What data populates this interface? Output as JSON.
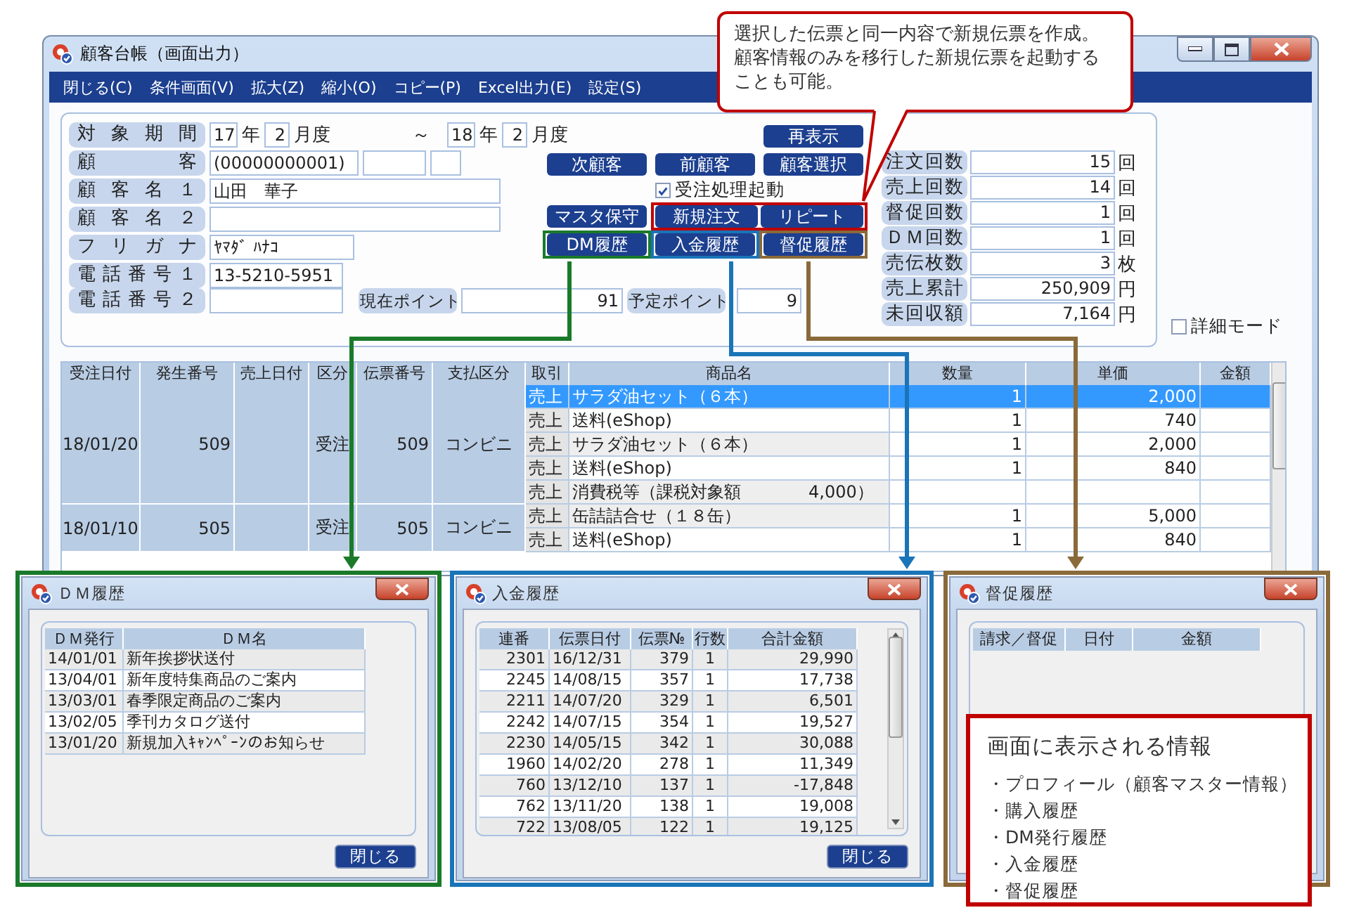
{
  "window": {
    "title": "顧客台帳（画面出力）"
  },
  "menu": [
    "閉じる(C)",
    "条件画面(V)",
    "拡大(Z)",
    "縮小(O)",
    "コピー(P)",
    "Excel出力(E)",
    "設定(S)"
  ],
  "form": {
    "period": {
      "label": "対象期間",
      "from_year": "17",
      "from_year_unit": "年",
      "from_month": "2",
      "from_month_unit": "月度",
      "separator": "～",
      "to_year": "18",
      "to_year_unit": "年",
      "to_month": "2",
      "to_month_unit": "月度"
    },
    "customer": {
      "label": "顧客",
      "code": "(00000000001)"
    },
    "name1": {
      "label": "顧客名１",
      "value": "山田　華子"
    },
    "name2": {
      "label": "顧客名２"
    },
    "kana": {
      "label": "フリガナ",
      "value": "ﾔﾏﾀﾞ ﾊﾅｺ"
    },
    "phone1": {
      "label": "電話番号１",
      "value": "13-5210-5951"
    },
    "phone2": {
      "label": "電話番号２"
    },
    "current_point": {
      "label": "現在ポイント",
      "value": "91"
    },
    "planned_point": {
      "label": "予定ポイント",
      "value": "9"
    }
  },
  "reload_button": "再表示",
  "nav_buttons": [
    "次顧客",
    "前顧客",
    "顧客選択"
  ],
  "auto_order": {
    "label": "受注処理起動",
    "checked": true
  },
  "action_buttons": [
    "マスタ保守",
    "新規注文",
    "リピート"
  ],
  "history_buttons": [
    {
      "label": "DM履歴",
      "color": "#1a7a2a"
    },
    {
      "label": "入金履歴",
      "color": "#1a74b8"
    },
    {
      "label": "督促履歴",
      "color": "#8a6a3a"
    }
  ],
  "stats": [
    {
      "label": "注文回数",
      "value": "15",
      "unit": "回"
    },
    {
      "label": "売上回数",
      "value": "14",
      "unit": "回"
    },
    {
      "label": "督促回数",
      "value": "1",
      "unit": "回"
    },
    {
      "label": "ＤＭ回数",
      "value": "1",
      "unit": "回"
    },
    {
      "label": "売伝枚数",
      "value": "3",
      "unit": "枚"
    },
    {
      "label": "売上累計",
      "value": "250,909",
      "unit": "円"
    },
    {
      "label": "未回収額",
      "value": "7,164",
      "unit": "円"
    }
  ],
  "detail_mode": {
    "label": "詳細モード",
    "checked": false
  },
  "table": {
    "columns": [
      "受注日付",
      "発生番号",
      "売上日付",
      "区分",
      "伝票番号",
      "支払区分",
      "取引",
      "商品名",
      "数量",
      "単価",
      "金額"
    ],
    "groups": [
      {
        "order_date": "18/01/20",
        "occur_no": "509",
        "type": "受注",
        "slip_no": "509",
        "payment": "コンビニ",
        "lines": [
          {
            "deal": "売上",
            "item": "サラダ油セット（６本）",
            "qty": "1",
            "price": "2,000",
            "selected": true
          },
          {
            "deal": "売上",
            "item": "送料(eShop)",
            "qty": "1",
            "price": "740",
            "selected": false
          },
          {
            "deal": "売上",
            "item": "サラダ油セット（６本）",
            "qty": "1",
            "price": "2,000",
            "selected": false
          },
          {
            "deal": "売上",
            "item": "送料(eShop)",
            "qty": "1",
            "price": "840",
            "selected": false
          },
          {
            "deal": "売上",
            "item": "消費税等（課税対象額　　　　4,000）",
            "selected": false
          }
        ]
      },
      {
        "order_date": "18/01/10",
        "occur_no": "505",
        "type": "受注",
        "slip_no": "505",
        "payment": "コンビニ",
        "lines": [
          {
            "deal": "売上",
            "item": "缶詰詰合せ（１８缶）",
            "qty": "1",
            "price": "5,000",
            "selected": false
          },
          {
            "deal": "売上",
            "item": "送料(eShop)",
            "qty": "1",
            "price": "840",
            "selected": false
          }
        ]
      }
    ]
  },
  "callout": {
    "text": "選択した伝票と同一内容で新規伝票を作成。顧客情報のみを移行した新規伝票を起動することも可能。"
  },
  "dm_history": {
    "title": "ＤＭ履歴",
    "columns": [
      "ＤＭ発行",
      "ＤＭ名"
    ],
    "rows": [
      [
        "14/01/01",
        "新年挨拶状送付"
      ],
      [
        "13/04/01",
        "新年度特集商品のご案内"
      ],
      [
        "13/03/01",
        "春季限定商品のご案内"
      ],
      [
        "13/02/05",
        "季刊カタログ送付"
      ],
      [
        "13/01/20",
        "新規加入ｷｬﾝﾍﾟｰﾝのお知らせ"
      ]
    ],
    "close_button": "閉じる"
  },
  "payment_history": {
    "title": "入金履歴",
    "columns": [
      "連番",
      "伝票日付",
      "伝票№",
      "行数",
      "合計金額"
    ],
    "rows": [
      [
        "2301",
        "16/12/31",
        "379",
        "1",
        "29,990"
      ],
      [
        "2245",
        "14/08/15",
        "357",
        "1",
        "17,738"
      ],
      [
        "2211",
        "14/07/20",
        "329",
        "1",
        "6,501"
      ],
      [
        "2242",
        "14/07/15",
        "354",
        "1",
        "19,527"
      ],
      [
        "2230",
        "14/05/15",
        "342",
        "1",
        "30,088"
      ],
      [
        "1960",
        "14/02/20",
        "278",
        "1",
        "11,349"
      ],
      [
        "760",
        "13/12/10",
        "137",
        "1",
        "-17,848"
      ],
      [
        "762",
        "13/11/20",
        "138",
        "1",
        "19,008"
      ],
      [
        "722",
        "13/08/05",
        "122",
        "1",
        "19,125"
      ]
    ],
    "close_button": "閉じる"
  },
  "dunning_history": {
    "title": "督促履歴",
    "columns": [
      "請求／督促",
      "日付",
      "金額"
    ]
  },
  "info_box": {
    "title": "画面に表示される情報",
    "items": [
      "・プロフィール（顧客マスター情報）",
      "・購入履歴",
      "・DM発行履歴",
      "・入金履歴",
      "・督促履歴"
    ]
  }
}
